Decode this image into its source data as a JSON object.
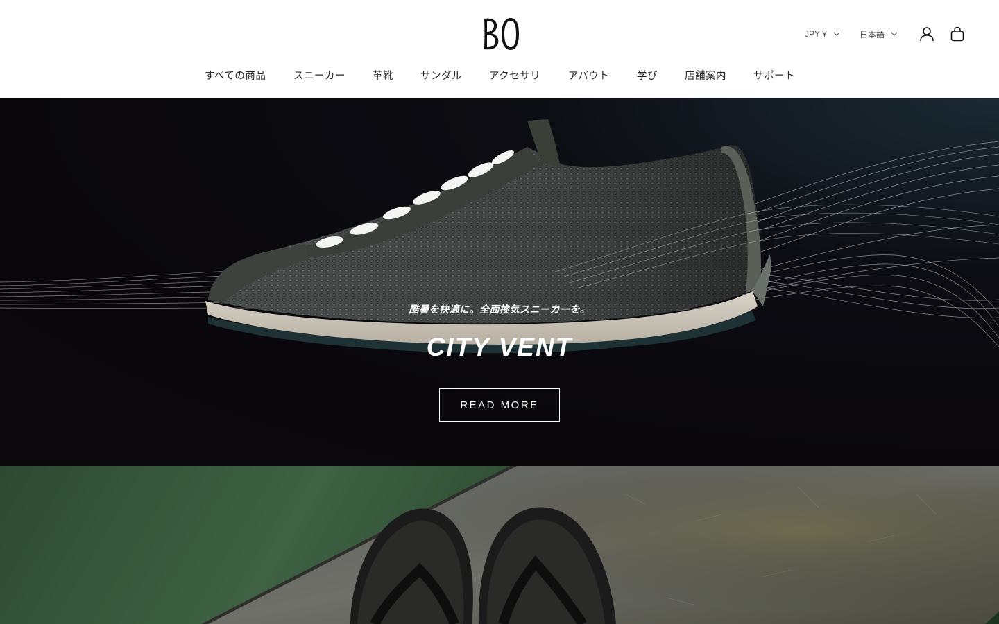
{
  "brand": {
    "logo_text": "BO"
  },
  "header": {
    "currency": {
      "label": "JPY ¥",
      "icon": "chevron-down-icon"
    },
    "language": {
      "label": "日本語",
      "icon": "chevron-down-icon"
    },
    "account_icon": "user-icon",
    "cart_icon": "bag-icon"
  },
  "nav": {
    "items": [
      {
        "label": "すべての商品"
      },
      {
        "label": "スニーカー"
      },
      {
        "label": "革靴"
      },
      {
        "label": "サンダル"
      },
      {
        "label": "アクセサリ"
      },
      {
        "label": "アバウト"
      },
      {
        "label": "学び"
      },
      {
        "label": "店舗案内"
      },
      {
        "label": "サポート"
      }
    ]
  },
  "hero": {
    "subtitle": "酷暑を快適に。全面換気スニーカーを。",
    "title": "CITY VENT",
    "cta_label": "READ MORE"
  },
  "colors": {
    "hero_bg": "#09070b",
    "banner_green": "#3e6243",
    "text_white": "#ffffff",
    "nav_text": "#262626"
  }
}
